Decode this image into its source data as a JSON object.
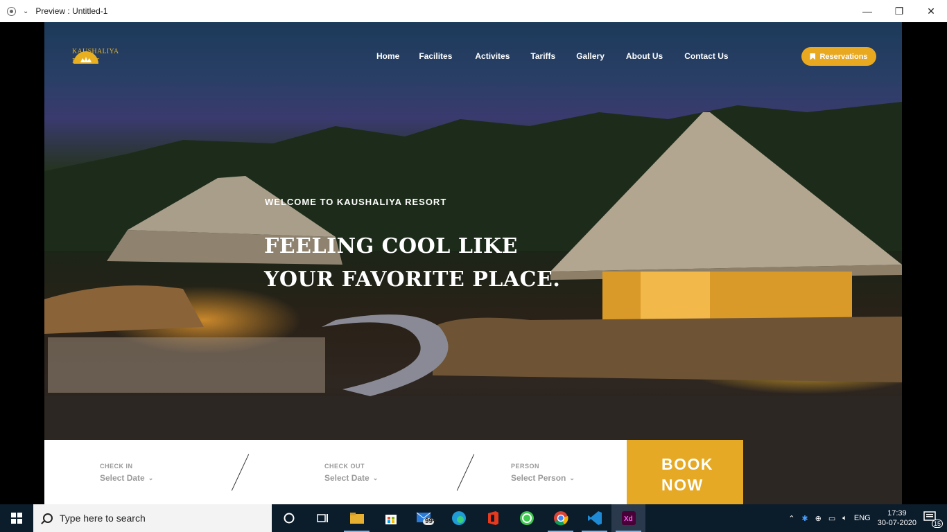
{
  "window": {
    "title": "Preview : Untitled-1",
    "controls": {
      "minimize": "—",
      "maximize": "❐",
      "close": "✕"
    }
  },
  "site": {
    "logo_line1": "KAUSHALIYA",
    "logo_line2": "RESORT",
    "nav": [
      "Home",
      "Facilites",
      "Activites",
      "Tariffs",
      "Gallery",
      "About Us",
      "Contact Us"
    ],
    "reservations_label": "Reservations",
    "welcome": "WELCOME TO KAUSHALIYA RESORT",
    "headline_line1": "FEELING COOL LIKE",
    "headline_line2": "YOUR FAVORITE PLACE.",
    "accent_color": "#e8a820"
  },
  "booking": {
    "check_in_label": "CHECK IN",
    "check_in_value": "Select Date",
    "check_out_label": "CHECK OUT",
    "check_out_value": "Select Date",
    "person_label": "PERSON",
    "person_value": "Select Person",
    "book_line1": "BOOK",
    "book_line2": "NOW"
  },
  "taskbar": {
    "search_placeholder": "Type here to search",
    "store_badge": "99+",
    "language": "ENG",
    "time": "17:39",
    "date": "30-07-2020",
    "notifications": "15"
  }
}
